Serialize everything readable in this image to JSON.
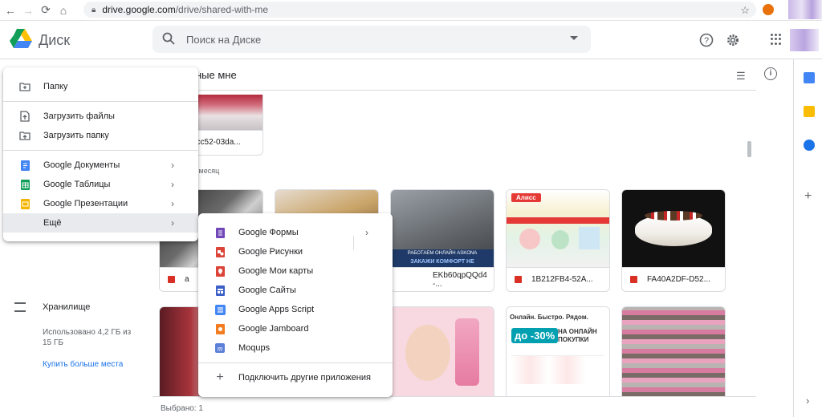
{
  "browser": {
    "url": "drive.google.com/drive/shared-with-me",
    "url_host": "drive.google.com",
    "url_path": "/drive/shared-with-me"
  },
  "header": {
    "brand": "Диск",
    "search_placeholder": "Поиск на Диске"
  },
  "main": {
    "title_partial": "ные мне",
    "section_label": "й месяц",
    "cards_row0": [
      {
        "caption": "c0ccc52-03da..."
      }
    ],
    "cards_row1": [
      {
        "caption": "a"
      },
      {
        "caption": ""
      },
      {
        "caption": "EKb60qpQQd4 -..."
      },
      {
        "caption": "1B212FB4-52A..."
      },
      {
        "caption": "FA40A2DF-D52..."
      }
    ],
    "thumb_labels": {
      "askona_banner": "РАБОТАЕМ ОНЛАЙН ASKONA",
      "askona_text": "ЗАКАЖИ КОМФОРТ НЕ",
      "alice_logo": "Алисс",
      "promo_head": "Онлайн. Быстро. Рядом.",
      "promo_pct": "до -30%",
      "promo_text": "НА ОНЛАЙН ПОКУПКИ"
    },
    "status": "Выбрано: 1"
  },
  "sidebar": {
    "storage_title": "Хранилище",
    "storage_text": "Использовано 4,2 ГБ из 15 ГБ",
    "buy_more": "Купить больше места"
  },
  "new_menu": {
    "items": [
      {
        "label": "Папку",
        "icon": "folder-plus-icon"
      },
      {
        "label": "Загрузить файлы",
        "icon": "file-upload-icon"
      },
      {
        "label": "Загрузить папку",
        "icon": "folder-upload-icon"
      },
      {
        "label": "Google Документы",
        "icon": "docs-icon",
        "color": "#4285f4"
      },
      {
        "label": "Google Таблицы",
        "icon": "sheets-icon",
        "color": "#0f9d58"
      },
      {
        "label": "Google Презентации",
        "icon": "slides-icon",
        "color": "#f4b400"
      },
      {
        "label": "Ещё",
        "icon": ""
      }
    ]
  },
  "more_menu": {
    "items": [
      {
        "label": "Google Формы",
        "icon": "forms-icon",
        "color": "#7248b9"
      },
      {
        "label": "Google Рисунки",
        "icon": "drawings-icon",
        "color": "#db4437"
      },
      {
        "label": "Google Мои карты",
        "icon": "mymaps-icon",
        "color": "#db4437"
      },
      {
        "label": "Google Сайты",
        "icon": "sites-icon",
        "color": "#3c5fc8"
      },
      {
        "label": "Google Apps Script",
        "icon": "apps-script-icon",
        "color": "#4285f4"
      },
      {
        "label": "Google Jamboard",
        "icon": "jamboard-icon",
        "color": "#f37c20"
      },
      {
        "label": "Moqups",
        "icon": "moqups-icon",
        "color": "#5b7fd6"
      },
      {
        "label": "Подключить другие приложения",
        "icon": "plus-icon"
      }
    ]
  }
}
